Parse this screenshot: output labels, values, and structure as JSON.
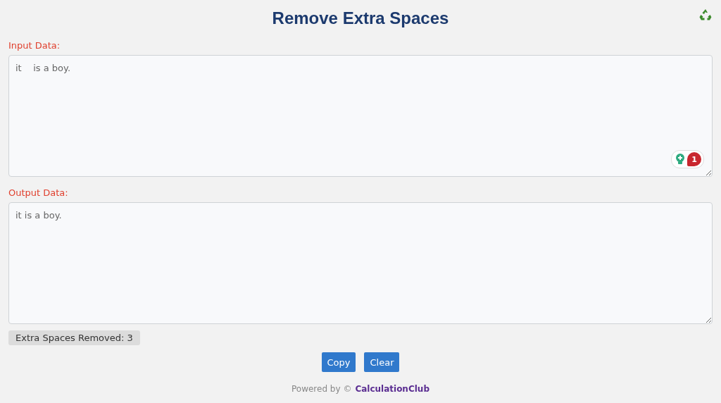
{
  "title": "Remove Extra Spaces",
  "input": {
    "label": "Input Data:",
    "value": "it    is a boy.",
    "grammar_count": "1"
  },
  "output": {
    "label": "Output Data:",
    "value": "it is a boy."
  },
  "result": "Extra Spaces Removed: 3",
  "buttons": [
    "Copy",
    "Clear"
  ],
  "footer": {
    "text": "Powered by ©",
    "link": "CalculationClub"
  }
}
